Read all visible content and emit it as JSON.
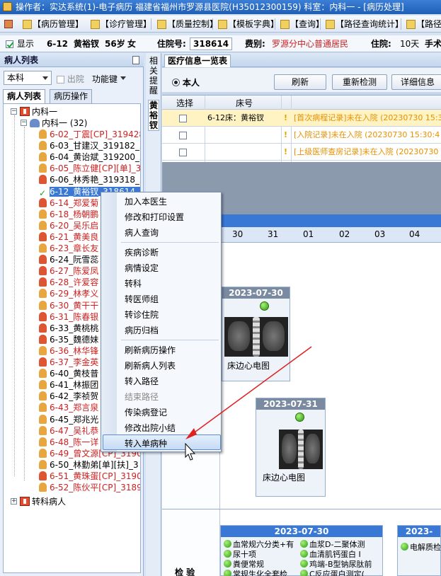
{
  "window": {
    "title": "操作者：实达系统(1)-电子病历  福建省福州市罗源县医院(H35012300159)  科室：内科一 - [病历处理]"
  },
  "menu": {
    "items": [
      "【病历管理】",
      "【诊疗管理】",
      "【质量控制】",
      "【模板字典】",
      "【查询】",
      "【路径查询统计】",
      "【路径"
    ]
  },
  "patient_bar": {
    "show_label": "显示",
    "bed": "6-12",
    "name": "黄裕钗",
    "age": "56岁",
    "sex": "女",
    "inpatient_no_label": "住院号:",
    "inpatient_no": "318614",
    "category_label": "费别:",
    "category": "罗源分中心普通居民",
    "stay_label": "住院:",
    "stay_days": "10天",
    "surgery_label": "手术"
  },
  "left_panel": {
    "title": "病人列表",
    "dept_select": "本科",
    "discharged_label": "出院",
    "function_label": "功能键",
    "tabs": [
      "病人列表",
      "病历操作"
    ],
    "tree": {
      "root": "内科一",
      "group": "内科一 (32)",
      "patients": [
        {
          "label": "6-02_丁震[CP]_319428_20",
          "red": true,
          "g": "m"
        },
        {
          "label": "6-03_甘建汉_319182_20",
          "red": false,
          "g": "m"
        },
        {
          "label": "6-04_黄诒斌_319200_20",
          "red": false,
          "g": "m"
        },
        {
          "label": "6-05_陈立健[CP][单]_3",
          "red": true,
          "g": "m"
        },
        {
          "label": "6-06_林秀艳_319318_20",
          "red": false,
          "g": "f"
        },
        {
          "label": "6-12_黄裕钗_318614_20",
          "red": false,
          "g": "c",
          "selected": true
        },
        {
          "label": "6-14_郑爱菊",
          "red": true,
          "g": "f"
        },
        {
          "label": "6-18_杨朝鹏",
          "red": true,
          "g": "m"
        },
        {
          "label": "6-20_吴乐启",
          "red": true,
          "g": "m"
        },
        {
          "label": "6-21_黄美良",
          "red": true,
          "g": "f"
        },
        {
          "label": "6-23_章长友",
          "red": true,
          "g": "m"
        },
        {
          "label": "6-24_阮雪蕊",
          "red": false,
          "g": "f"
        },
        {
          "label": "6-27_陈爱凤",
          "red": true,
          "g": "f"
        },
        {
          "label": "6-28_许爱容",
          "red": true,
          "g": "f"
        },
        {
          "label": "6-29_林孝义",
          "red": true,
          "g": "m"
        },
        {
          "label": "6-30_黄干干",
          "red": true,
          "g": "m"
        },
        {
          "label": "6-31_陈春银",
          "red": true,
          "g": "f"
        },
        {
          "label": "6-33_黄桃桃",
          "red": false,
          "g": "f"
        },
        {
          "label": "6-35_魏德妹",
          "red": false,
          "g": "f"
        },
        {
          "label": "6-36_林华锋",
          "red": true,
          "g": "m"
        },
        {
          "label": "6-37_李金英",
          "red": true,
          "g": "f"
        },
        {
          "label": "6-40_黄枝普",
          "red": false,
          "g": "m"
        },
        {
          "label": "6-41_林振团",
          "red": false,
          "g": "m"
        },
        {
          "label": "6-42_李祯贺",
          "red": false,
          "g": "m"
        },
        {
          "label": "6-43_郑言泉",
          "red": true,
          "g": "m"
        },
        {
          "label": "6-45_郑兆光",
          "red": false,
          "g": "m"
        },
        {
          "label": "6-47_吴礼恭",
          "red": true,
          "g": "m"
        },
        {
          "label": "6-48_陈一详",
          "red": true,
          "g": "m"
        },
        {
          "label": "6-49_曾文源[CP]_31904",
          "red": true,
          "g": "m"
        },
        {
          "label": "6-50_林勤弟[单][扶]_3",
          "red": false,
          "g": "m"
        },
        {
          "label": "6-51_黄珠蛋[CP]_31904",
          "red": true,
          "g": "f"
        },
        {
          "label": "6-52_陈伙平[CP]_31891",
          "red": true,
          "g": "m"
        }
      ],
      "other": "转科病人"
    }
  },
  "side_strip": {
    "top": "相关提醒",
    "bottom": "黄裕钗"
  },
  "main": {
    "title": "医疗信息一览表",
    "self_radio": "本人",
    "buttons": [
      "刷新",
      "重新检测",
      "详细信息"
    ],
    "grid": {
      "headers": [
        "选择",
        "床号"
      ],
      "rows": [
        {
          "bed": "6-12床：黄裕钗",
          "msg": "[首次病程记录]未在入院 (20230730  15:3"
        },
        {
          "bed": "",
          "msg": "[入院记录]未在入院 (20230730  15:30:4"
        },
        {
          "bed": "",
          "msg": "[上级医师查房记录]未在入院 (20230730"
        }
      ]
    },
    "timeline": {
      "dates": [
        "30",
        "31",
        "01",
        "02",
        "03",
        "04"
      ],
      "cards": [
        {
          "date": "2023-07-30",
          "label": "床边心电图"
        },
        {
          "date": "2023-07-31",
          "label": "床边心电图"
        }
      ],
      "exam_label": "检  验",
      "exam_cards": [
        {
          "date": "2023-07-30",
          "items": [
            "血常规六分类+有",
            "血浆D-二聚体测",
            "尿十项",
            "血清肌钙蛋白 I",
            "粪便常规",
            "鸡端-B型钠尿肽前",
            "常规生化全套检",
            "C反应蛋白测定("
          ]
        },
        {
          "date": "2023-",
          "items": [
            "电解质检"
          ]
        }
      ]
    }
  },
  "context_menu": {
    "items": [
      {
        "label": "加入本医生",
        "disabled": false
      },
      {
        "label": "修改和打印设置",
        "disabled": false
      },
      {
        "label": "病人查询",
        "disabled": false
      },
      {
        "label": "疾病诊断",
        "disabled": false
      },
      {
        "label": "病情设定",
        "disabled": false
      },
      {
        "label": "转科",
        "disabled": false
      },
      {
        "label": "转医师组",
        "disabled": false
      },
      {
        "label": "转诊住院",
        "disabled": false
      },
      {
        "label": "病历归档",
        "disabled": false
      },
      {
        "label": "刷新病历操作",
        "disabled": false
      },
      {
        "label": "刷新病人列表",
        "disabled": false
      },
      {
        "label": "转入路径",
        "disabled": false
      },
      {
        "label": "结束路径",
        "disabled": true
      },
      {
        "label": "传染病登记",
        "disabled": false
      },
      {
        "label": "修改出院小结",
        "disabled": false
      },
      {
        "label": "转入单病种",
        "disabled": false,
        "highlighted": true
      }
    ]
  }
}
